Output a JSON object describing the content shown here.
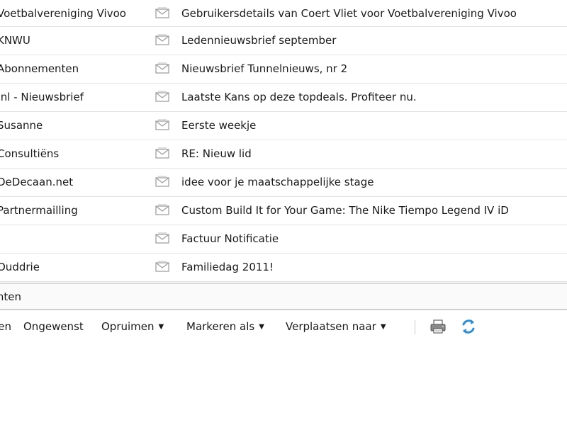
{
  "messages": [
    {
      "sender": "Voetbalvereniging Vivoo",
      "subject": "Gebruikersdetails van Coert Vliet voor Voetbalvereniging Vivoo"
    },
    {
      "sender": "KNWU",
      "subject": "Ledennieuwsbrief september"
    },
    {
      "sender": "Abonnementen",
      "subject": "Nieuwsbrief Tunnelnieuws, nr 2"
    },
    {
      "sender": ".nl - Nieuwsbrief",
      "subject": "Laatste Kans op deze topdeals. Profiteer nu."
    },
    {
      "sender": "Susanne",
      "subject": "Eerste weekje"
    },
    {
      "sender": "Consultiëns",
      "subject": "RE: Nieuw lid"
    },
    {
      "sender": "DeDecaan.net",
      "subject": "idee voor je maatschappelijke stage"
    },
    {
      "sender": "Partnermailling",
      "subject": "Custom Build It for Your Game: The Nike Tiempo Legend IV iD"
    },
    {
      "sender": "",
      "subject": "Factuur Notificatie"
    },
    {
      "sender": "Ouddrie",
      "subject": "Familiedag 2011!"
    }
  ],
  "folder_bar": {
    "label": "Berichten"
  },
  "toolbar": {
    "first_label": "Verwijderen",
    "spam_label": "Ongewenst",
    "cleanup_label": "Opruimen",
    "mark_label": "Markeren als",
    "move_label": "Verplaatsen naar",
    "arrow": "▼"
  },
  "icons": {
    "message": "envelope-icon",
    "print": "printer-icon",
    "refresh": "refresh-icon"
  },
  "colors": {
    "refresh": "#2a8fd6",
    "row_border": "#e3e3e3"
  }
}
